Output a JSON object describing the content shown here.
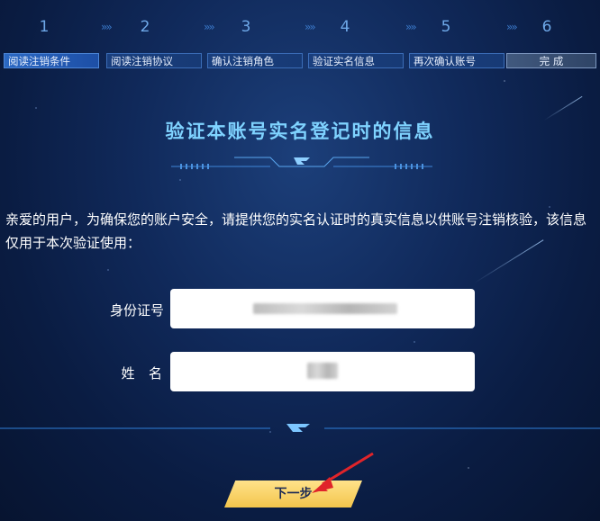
{
  "steps": [
    {
      "number": "1",
      "label": "阅读注销条件"
    },
    {
      "number": "2",
      "label": "阅读注销协议"
    },
    {
      "number": "3",
      "label": "确认注销角色"
    },
    {
      "number": "4",
      "label": "验证实名信息"
    },
    {
      "number": "5",
      "label": "再次确认账号"
    },
    {
      "number": "6",
      "label": "完 成"
    }
  ],
  "step_arrows": "»»",
  "title": "验证本账号实名登记时的信息",
  "description": "亲爱的用户，为确保您的账户安全，请提供您的实名认证时的真实信息以供账号注销核验，该信息仅用于本次验证使用：",
  "form": {
    "id_label": "身份证号",
    "name_label": "姓  名"
  },
  "next_button": "下一步",
  "colors": {
    "accent_title": "#7fd3ff",
    "button_yellow": "#f3c54c",
    "arrow_red": "#e0242a"
  }
}
